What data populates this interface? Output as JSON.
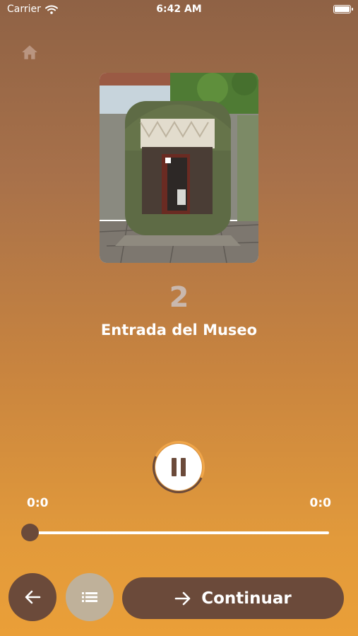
{
  "status_bar": {
    "carrier": "Carrier",
    "time": "6:42 AM"
  },
  "icons": {
    "home": "home-icon",
    "back": "arrow-left-icon",
    "list": "list-icon",
    "continue": "arrow-right-icon",
    "pause": "pause-icon"
  },
  "stop": {
    "number": "2",
    "title": "Entrada del Museo"
  },
  "player": {
    "elapsed": "0:0",
    "duration": "0:0",
    "progress": 0,
    "state": "playing"
  },
  "footer": {
    "continue_label": "Continuar"
  },
  "colors": {
    "primary": "#6b4a3a",
    "accent": "#f0a64a",
    "secondary": "#bfb19a"
  }
}
